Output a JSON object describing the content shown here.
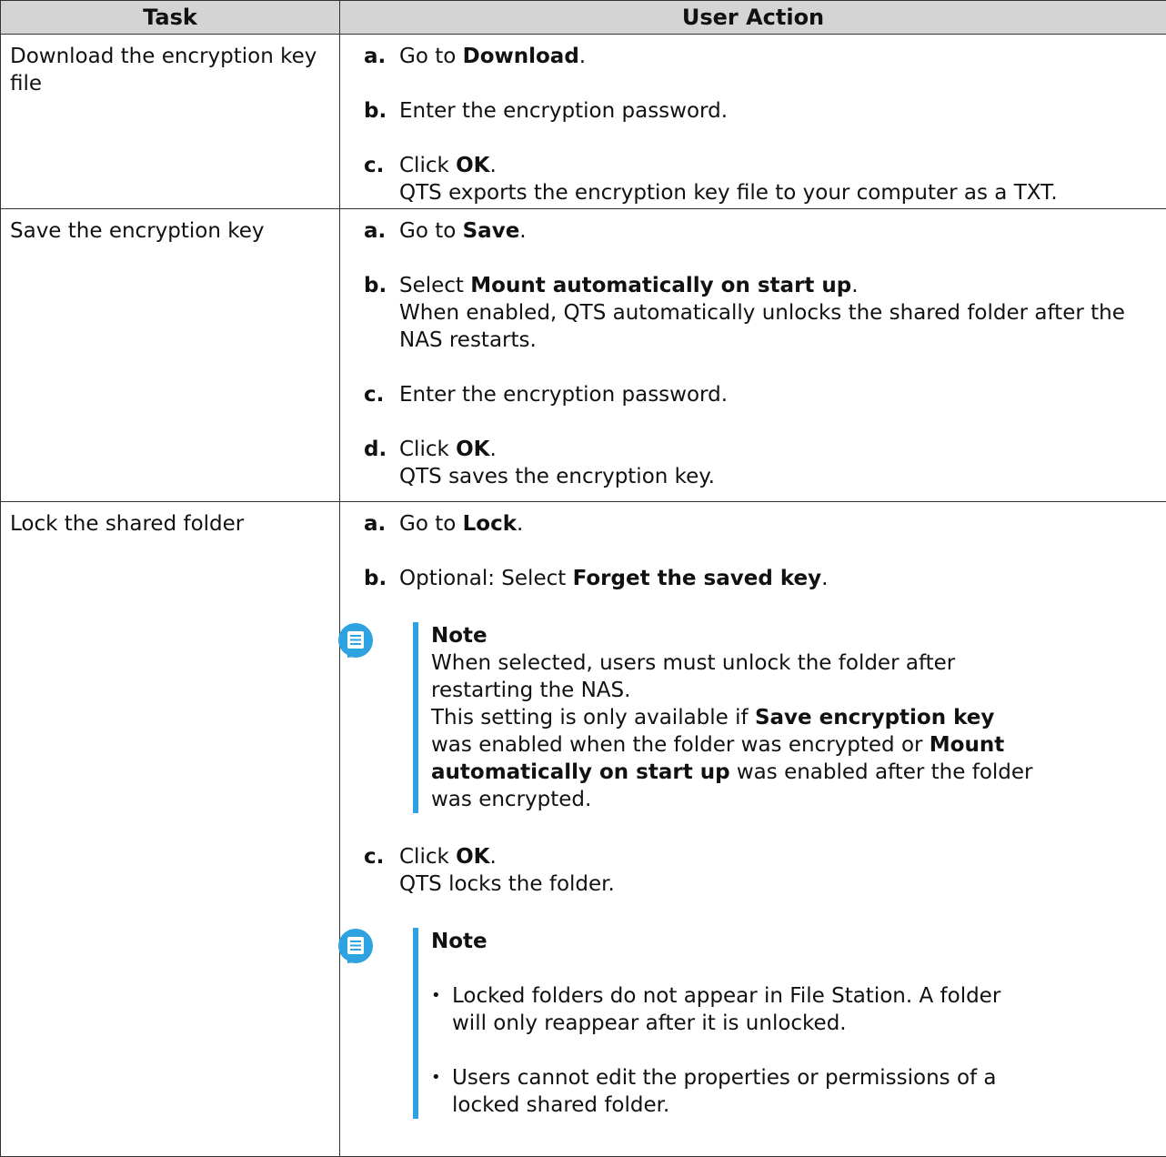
{
  "headers": {
    "task": "Task",
    "action": "User Action"
  },
  "rows": [
    {
      "task": "Download the encryption key file",
      "steps": [
        {
          "letter": "a.",
          "pre": "Go to ",
          "bold": "Download",
          "post": "."
        },
        {
          "letter": "b.",
          "text": "Enter the encryption password."
        },
        {
          "letter": "c.",
          "pre": "Click ",
          "bold": "OK",
          "post": ".",
          "sub": "QTS exports the encryption key file to your computer as a TXT."
        }
      ]
    },
    {
      "task": "Save the encryption key",
      "steps": [
        {
          "letter": "a.",
          "pre": "Go to ",
          "bold": "Save",
          "post": "."
        },
        {
          "letter": "b.",
          "pre": "Select ",
          "bold": "Mount automatically on start up",
          "post": ".",
          "sub": "When enabled, QTS automatically unlocks the shared folder after the NAS restarts."
        },
        {
          "letter": "c.",
          "text": "Enter the encryption password."
        },
        {
          "letter": "d.",
          "pre": "Click ",
          "bold": "OK",
          "post": ".",
          "sub": "QTS saves the encryption key."
        }
      ]
    },
    {
      "task": "Lock the shared folder",
      "steps": [
        {
          "letter": "a.",
          "pre": "Go to ",
          "bold": "Lock",
          "post": "."
        },
        {
          "letter": "b.",
          "pre": "Optional: Select ",
          "bold": "Forget the saved key",
          "post": "."
        },
        {
          "letter": "c.",
          "pre": "Click ",
          "bold": "OK",
          "post": ".",
          "sub": "QTS locks the folder."
        }
      ],
      "note1": {
        "title": "Note",
        "line1": "When selected, users must unlock the folder after restarting the NAS.",
        "l2_pre": "This setting is only available if ",
        "l2_b1": "Save encryption key",
        "l2_mid": " was enabled when the folder was encrypted or ",
        "l2_b2": "Mount automatically on start up",
        "l2_post": " was enabled after the folder was encrypted."
      },
      "note2": {
        "title": "Note",
        "bullet_char": "•",
        "bullets": [
          "Locked folders do not appear in File Station. A folder will only reappear after it is unlocked.",
          "Users cannot edit the properties or permissions of a locked shared folder."
        ]
      }
    }
  ],
  "colors": {
    "header_bg": "#d4d4d4",
    "accent": "#2fa3e0",
    "border": "#333333"
  },
  "icons": {
    "note": "note-icon"
  }
}
